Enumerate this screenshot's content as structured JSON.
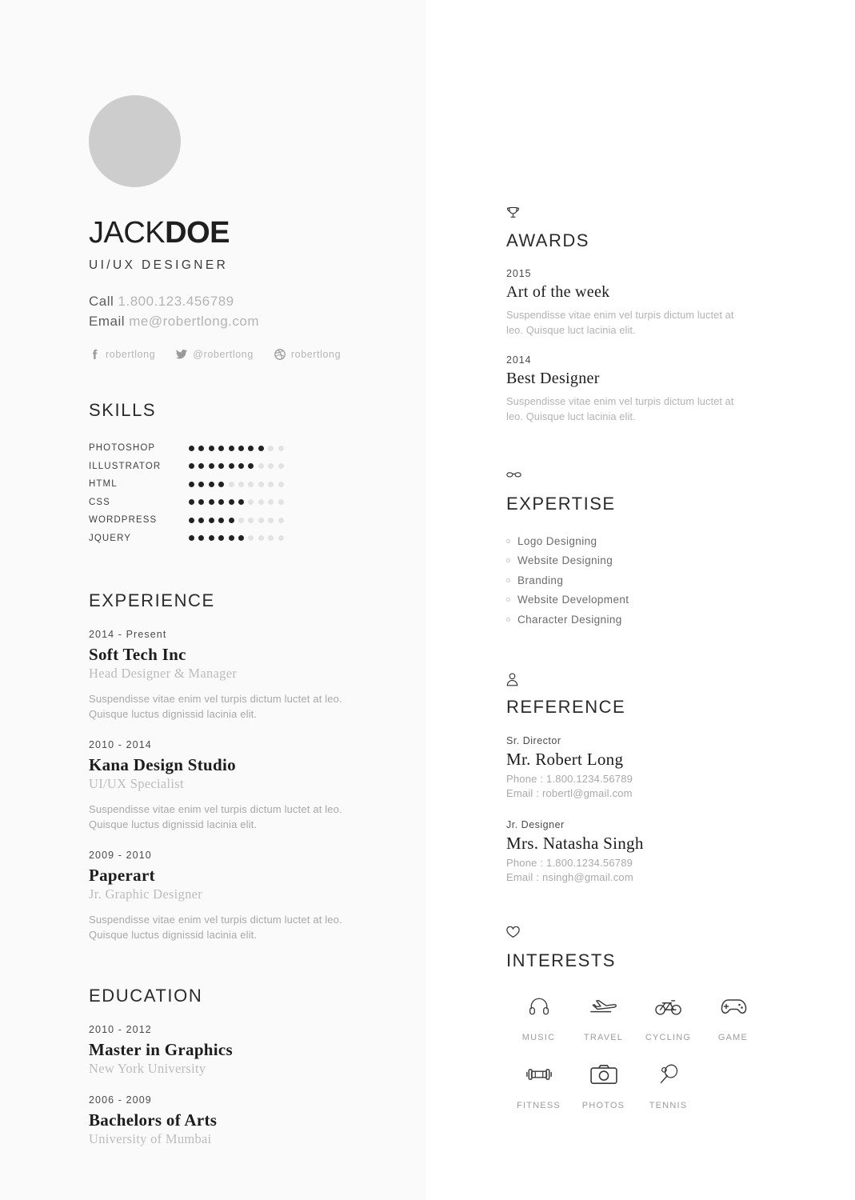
{
  "profile": {
    "first_name": "JACK",
    "last_name": "DOE",
    "job_title": "UI/UX DESIGNER",
    "avatar_color": "#cdcdcd",
    "contact": {
      "call_label": "Call",
      "phone": "1.800.123.456789",
      "email_label": "Email",
      "email": "me@robertlong.com"
    },
    "social": [
      {
        "icon": "facebook-icon",
        "handle": "robertlong"
      },
      {
        "icon": "twitter-icon",
        "handle": "@robertlong"
      },
      {
        "icon": "dribbble-icon",
        "handle": "robertlong"
      }
    ]
  },
  "skills": {
    "heading": "SKILLS",
    "max": 10,
    "items": [
      {
        "name": "PHOTOSHOP",
        "level": 8
      },
      {
        "name": "ILLUSTRATOR",
        "level": 7
      },
      {
        "name": "HTML",
        "level": 4
      },
      {
        "name": "CSS",
        "level": 6
      },
      {
        "name": "WORDPRESS",
        "level": 5
      },
      {
        "name": "JQUERY",
        "level": 6
      }
    ]
  },
  "experience": {
    "heading": "EXPERIENCE",
    "items": [
      {
        "date": "2014 - Present",
        "title": "Soft Tech Inc",
        "subtitle": "Head Designer & Manager",
        "description": "Suspendisse vitae enim vel turpis dictum luctet at leo. Quisque luctus dignissid lacinia elit."
      },
      {
        "date": "2010 - 2014",
        "title": "Kana Design Studio",
        "subtitle": "UI/UX Specialist",
        "description": "Suspendisse vitae enim vel turpis dictum luctet at leo. Quisque luctus dignissid lacinia elit."
      },
      {
        "date": "2009 - 2010",
        "title": "Paperart",
        "subtitle": "Jr. Graphic Designer",
        "description": "Suspendisse vitae enim vel turpis dictum luctet at leo. Quisque luctus dignissid lacinia elit."
      }
    ]
  },
  "education": {
    "heading": "EDUCATION",
    "items": [
      {
        "date": "2010 - 2012",
        "title": "Master in Graphics",
        "subtitle": "New York University"
      },
      {
        "date": "2006 - 2009",
        "title": "Bachelors of Arts",
        "subtitle": "University of Mumbai"
      }
    ]
  },
  "awards": {
    "icon": "trophy-icon",
    "heading": "AWARDS",
    "items": [
      {
        "date": "2015",
        "title": "Art of the week",
        "description": "Suspendisse vitae enim vel turpis dictum luctet at leo. Quisque luct lacinia elit."
      },
      {
        "date": "2014",
        "title": "Best Designer",
        "description": "Suspendisse vitae enim vel turpis dictum luctet at leo. Quisque luct lacinia elit."
      }
    ]
  },
  "expertise": {
    "icon": "glasses-icon",
    "heading": "EXPERTISE",
    "items": [
      "Logo Designing",
      "Website Designing",
      "Branding",
      "Website Development",
      "Character Designing"
    ]
  },
  "reference": {
    "icon": "person-icon",
    "heading": "REFERENCE",
    "items": [
      {
        "role": "Sr. Director",
        "name": "Mr. Robert Long",
        "phone": "Phone : 1.800.1234.56789",
        "email": "Email : robertl@gmail.com"
      },
      {
        "role": "Jr. Designer",
        "name": "Mrs. Natasha Singh",
        "phone": "Phone : 1.800.1234.56789",
        "email": "Email : nsingh@gmail.com"
      }
    ]
  },
  "interests": {
    "icon": "heart-icon",
    "heading": "INTERESTS",
    "items": [
      {
        "icon": "headphones-icon",
        "label": "MUSIC"
      },
      {
        "icon": "airplane-icon",
        "label": "TRAVEL"
      },
      {
        "icon": "bicycle-icon",
        "label": "CYCLING"
      },
      {
        "icon": "gamepad-icon",
        "label": "GAME"
      },
      {
        "icon": "dumbbell-icon",
        "label": "FITNESS"
      },
      {
        "icon": "camera-icon",
        "label": "PHOTOS"
      },
      {
        "icon": "pingpong-icon",
        "label": "TENNIS"
      }
    ]
  }
}
